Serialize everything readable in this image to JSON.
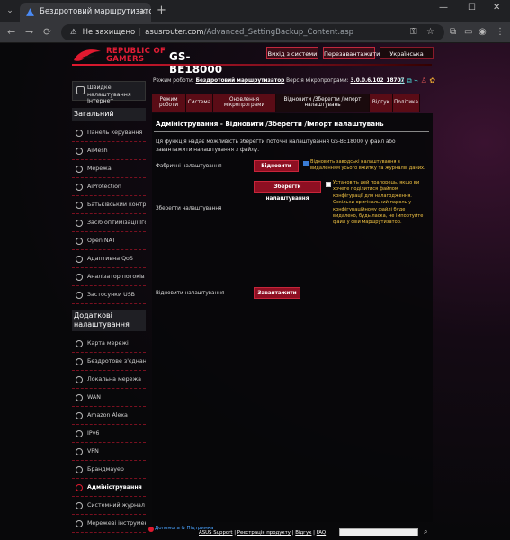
{
  "browser": {
    "tab_title": "Бездротовий маршрутизатор A",
    "tab_close": "×",
    "new_tab": "+",
    "window_controls": [
      "—",
      "☐",
      "✕"
    ],
    "security_label": "Не захищено",
    "url_host": "asusrouter.com",
    "url_path": "/Advanced_SettingBackup_Content.asp",
    "nav_icons": [
      "back-icon",
      "forward-icon",
      "reload-icon"
    ]
  },
  "header": {
    "brand_line1": "REPUBLIC OF",
    "brand_line2": "GAMERS",
    "model": "GS-BE18000",
    "logout_label": "Вихід з системи",
    "reboot_label": "Перезавантажити",
    "language": "Українська"
  },
  "status": {
    "mode_label": "Режим роботи:",
    "mode_value": "Бездротовий маршрутизатор",
    "firmware_label": "Версія мікропрограми:",
    "firmware_value": "3.0.0.6.102_18707",
    "accent": "#e0192f"
  },
  "sidebar": {
    "quick_label": "Швидке налаштування Інтернет",
    "general_header": "Загальний",
    "general_items": [
      "Панель керування",
      "AiMesh",
      "Мережа",
      "AiProtection",
      "Батьківський контроль",
      "Засіб оптимізації Ігор",
      "Open NAT",
      "Адаптивна QoS",
      "Аналізатор потоків",
      "Застосунки USB"
    ],
    "advanced_header": "Додаткові налаштування",
    "advanced_items": [
      "Карта мережі",
      "Бездротове з'єднання",
      "Локальна мережа",
      "WAN",
      "Amazon Alexa",
      "IPv6",
      "VPN",
      "Брандмауер",
      "Адміністрування",
      "Системний журнал",
      "Мережеві інструменти"
    ]
  },
  "tabs": [
    "Режим роботи",
    "Система",
    "Оновлення мікропрограми",
    "Відновити /Зберегти /Імпорт налаштувань",
    "Відгук",
    "Політика"
  ],
  "content": {
    "title": "Адміністрування - Відновити /Зберегти /Імпорт налаштувань",
    "description": "Ця функція надає можливість зберегти поточні налаштування GS-BE18000 у файл або завантажити налаштування з файлу.",
    "factory_label": "Фабричні налаштування",
    "factory_button": "Відновити",
    "factory_note": "Відновить заводські налаштування з видаленням усього вжитку та журналів даних.",
    "save_label": "Зберегти налаштування",
    "save_button": "Зберегти налаштування",
    "save_note": "Установіть цей прапорець, якщо ви хочете поділитися файлом конфігурації для налагодження. Оскільки оригінальний пароль у конфігураційному файлі буде видалено, будь ласка, не імпортуйте файл у свій маршрутизатор.",
    "restore_label": "Відновити налаштування",
    "restore_button": "Завантажити"
  },
  "footer": {
    "help": "Допомога & Підтримка",
    "links": [
      "ASUS Support",
      "Реєстрація продукту",
      "Відгук",
      "FAQ"
    ]
  }
}
